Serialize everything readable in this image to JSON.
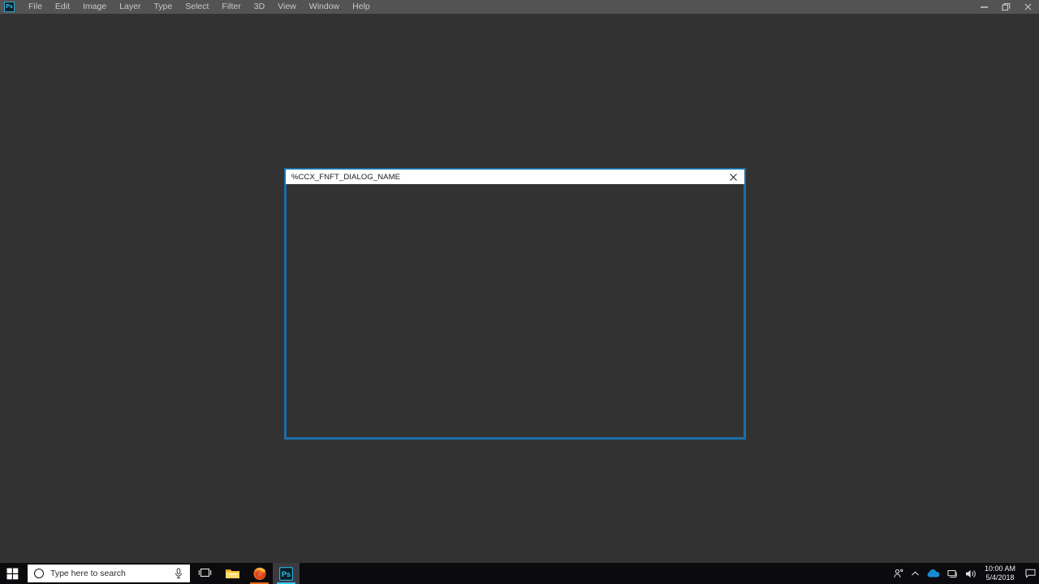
{
  "app": {
    "name": "Adobe Photoshop",
    "icon": "photoshop-app-icon",
    "icon_label": "Ps",
    "accent_color": "#31c5f0",
    "menu": [
      {
        "label": "File"
      },
      {
        "label": "Edit"
      },
      {
        "label": "Image"
      },
      {
        "label": "Layer"
      },
      {
        "label": "Type"
      },
      {
        "label": "Select"
      },
      {
        "label": "Filter"
      },
      {
        "label": "3D"
      },
      {
        "label": "View"
      },
      {
        "label": "Window"
      },
      {
        "label": "Help"
      }
    ],
    "window_controls": {
      "minimize": "minimize-icon",
      "restore": "restore-icon",
      "close": "close-icon"
    },
    "canvas_background": "#323232"
  },
  "dialog": {
    "title": "%CCX_FNFT_DIALOG_NAME",
    "close_label": "×",
    "border_color": "#1b6ea8",
    "titlebar_background": "#ffffff",
    "body_background": "#323232",
    "body_content": ""
  },
  "taskbar": {
    "background": "#0b0b0e",
    "start": {
      "name": "start-button",
      "label": "Start"
    },
    "search": {
      "placeholder": "Type here to search",
      "cortana_icon": "cortana-circle-icon",
      "mic_icon": "microphone-icon"
    },
    "taskview": {
      "label": "Task View",
      "icon": "task-view-icon"
    },
    "apps": [
      {
        "name": "file-explorer",
        "label": "File Explorer",
        "icon": "folder-icon",
        "active": false,
        "underline": "#ffffff00"
      },
      {
        "name": "firefox",
        "label": "Mozilla Firefox",
        "icon": "firefox-icon",
        "active": false,
        "underline": "#e8661a"
      },
      {
        "name": "photoshop",
        "label": "Adobe Photoshop",
        "icon": "photoshop-icon",
        "active": true,
        "underline": "#31c5f0"
      }
    ],
    "tray": {
      "icons": [
        {
          "name": "people-icon",
          "label": "People"
        },
        {
          "name": "show-hidden-icons-chevron",
          "label": "Show hidden icons"
        },
        {
          "name": "onedrive-cloud-icon",
          "label": "OneDrive"
        },
        {
          "name": "network-icon",
          "label": "Network"
        },
        {
          "name": "volume-icon",
          "label": "Volume"
        }
      ],
      "clock": {
        "time": "10:00 AM",
        "date": "5/4/2018"
      },
      "action_center": {
        "name": "action-center-icon",
        "label": "Notifications"
      }
    }
  }
}
